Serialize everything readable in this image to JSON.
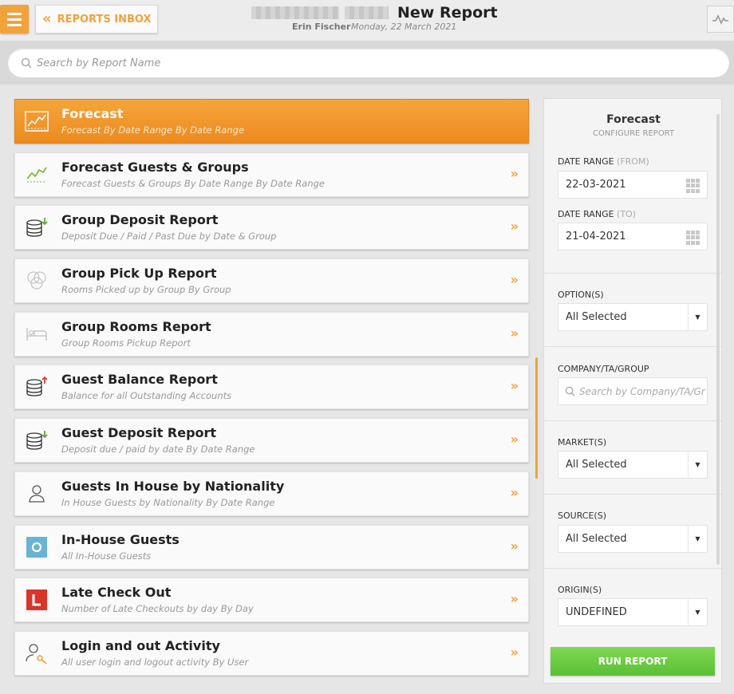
{
  "header": {
    "menu_icon": "hamburger-icon",
    "inbox_label": "REPORTS INBOX",
    "title": "New Report",
    "user": "Erin Fischer",
    "date": "Monday, 22 March 2021",
    "activity_icon": "activity-pulse-icon"
  },
  "search": {
    "placeholder": "Search by Report Name"
  },
  "reports": [
    {
      "title": "Forecast",
      "subtitle": "Forecast By Date Range By Date Range",
      "icon": "chart-icon",
      "active": true
    },
    {
      "title": "Forecast Guests & Groups",
      "subtitle": "Forecast Guests & Groups By Date Range By Date Range",
      "icon": "chart-icon"
    },
    {
      "title": "Group Deposit Report",
      "subtitle": "Deposit Due / Paid / Past Due by Date & Group",
      "icon": "coins-down-icon"
    },
    {
      "title": "Group Pick Up Report",
      "subtitle": "Rooms Picked up by Group By Group",
      "icon": "circles-icon"
    },
    {
      "title": "Group Rooms Report",
      "subtitle": "Group Rooms Pickup Report",
      "icon": "bed-icon"
    },
    {
      "title": "Guest Balance Report",
      "subtitle": "Balance for all Outstanding Accounts",
      "icon": "coins-up-icon"
    },
    {
      "title": "Guest Deposit Report",
      "subtitle": "Deposit due / paid by date By Date Range",
      "icon": "coins-down-icon"
    },
    {
      "title": "Guests In House by Nationality",
      "subtitle": "In House Guests by Nationality By Date Range",
      "icon": "person-icon"
    },
    {
      "title": "In-House Guests",
      "subtitle": "All In-House Guests",
      "icon": "inhouse-icon"
    },
    {
      "title": "Late Check Out",
      "subtitle": "Number of Late Checkouts by day By Day",
      "icon": "late-l-icon"
    },
    {
      "title": "Login and out Activity",
      "subtitle": "All user login and logout activity By User",
      "icon": "user-key-icon"
    }
  ],
  "config": {
    "title": "Forecast",
    "subtitle": "CONFIGURE REPORT",
    "date_from_label": "DATE RANGE",
    "date_from_hint": "(FROM)",
    "date_from_value": "22-03-2021",
    "date_to_label": "DATE RANGE",
    "date_to_hint": "(TO)",
    "date_to_value": "21-04-2021",
    "options_label": "OPTION(S)",
    "options_value": "All Selected",
    "company_label": "COMPANY/TA/GROUP",
    "company_placeholder": "Search by Company/TA/Gr",
    "market_label": "MARKET(S)",
    "market_value": "All Selected",
    "source_label": "SOURCE(S)",
    "source_value": "All Selected",
    "origin_label": "ORIGIN(S)",
    "origin_value": "UNDEFINED",
    "run_label": "RUN REPORT"
  },
  "colors": {
    "accent": "#f2a23a",
    "run_button": "#6ccb44"
  }
}
